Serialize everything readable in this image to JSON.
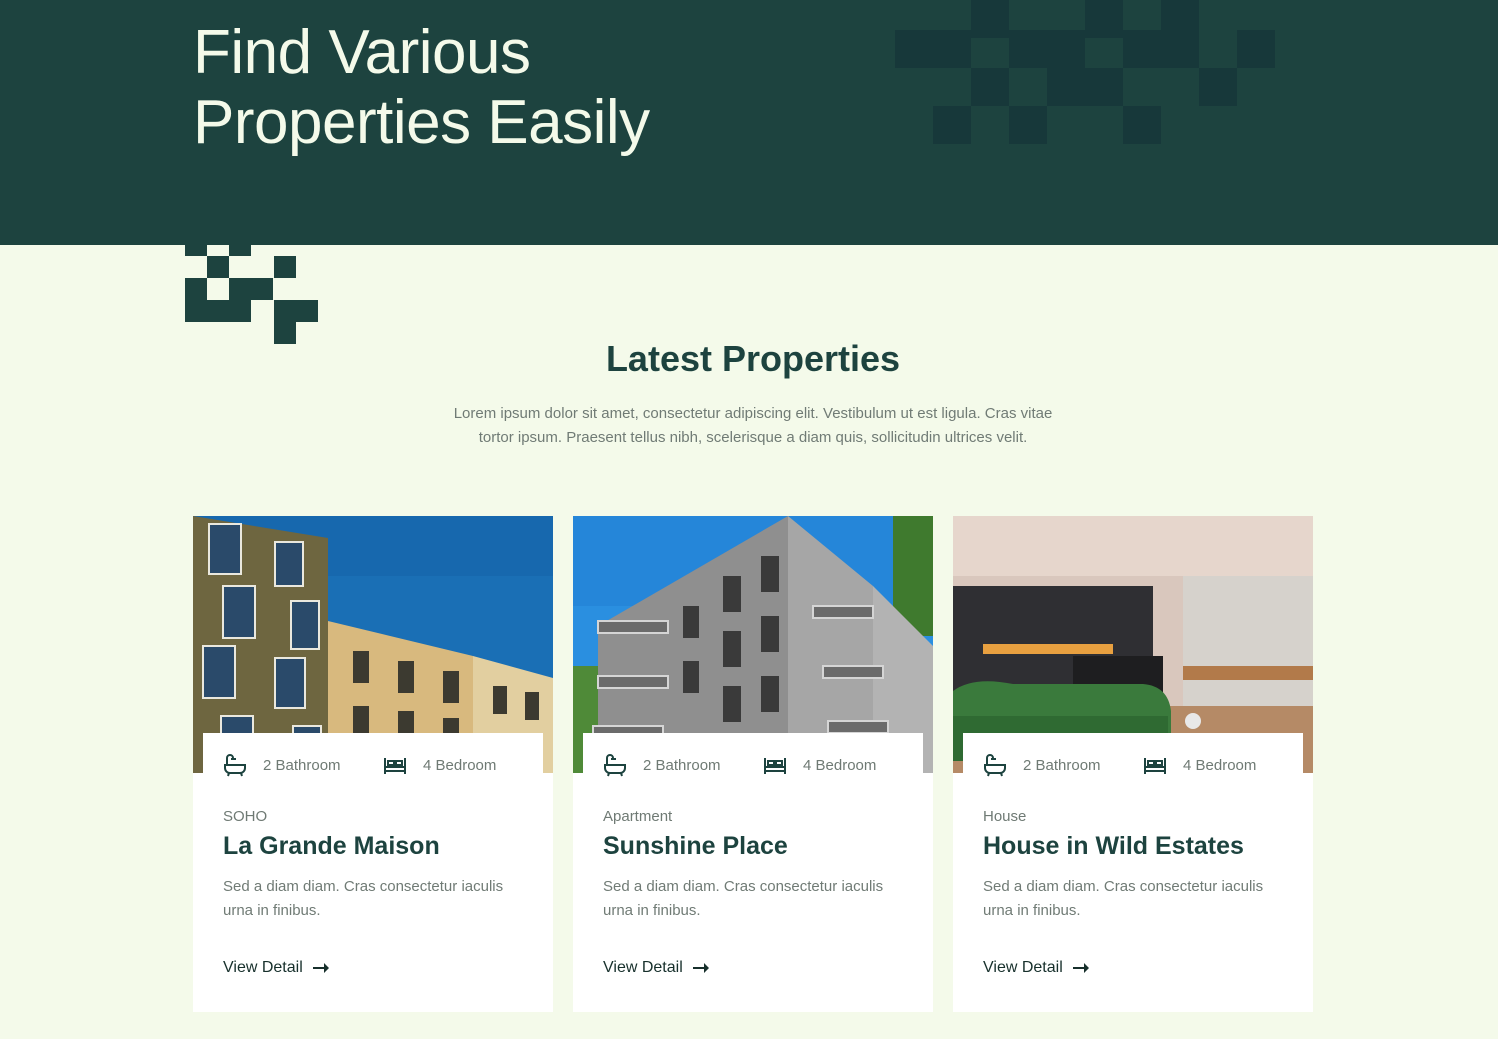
{
  "hero": {
    "title_line1": "Find Various",
    "title_line2": "Properties Easily"
  },
  "latest": {
    "title": "Latest Properties",
    "description": "Lorem ipsum dolor sit amet, consectetur adipiscing elit. Vestibulum ut est ligula. Cras vitae tortor ipsum. Praesent tellus nibh, scelerisque a diam quis, sollicitudin ultrices velit."
  },
  "properties": [
    {
      "bathrooms": "2 Bathroom",
      "bedrooms": "4 Bedroom",
      "category": "SOHO",
      "name": "La Grande Maison",
      "summary": "Sed a diam diam. Cras consectetur iaculis urna in finibus.",
      "cta": "View Detail"
    },
    {
      "bathrooms": "2 Bathroom",
      "bedrooms": "4 Bedroom",
      "category": "Apartment",
      "name": "Sunshine Place",
      "summary": "Sed a diam diam. Cras consectetur iaculis urna in finibus.",
      "cta": "View Detail"
    },
    {
      "bathrooms": "2 Bathroom",
      "bedrooms": "4 Bedroom",
      "category": "House",
      "name": "House in Wild Estates",
      "summary": "Sed a diam diam. Cras consectetur iaculis urna in finibus.",
      "cta": "View Detail"
    }
  ],
  "icons": {
    "bath": "bathtub-icon",
    "bed": "bed-icon",
    "arrow": "arrow-right-icon"
  },
  "colors": {
    "brand_dark": "#1d433f",
    "background": "#f4faea",
    "hero_text": "#f4faea",
    "muted_text": "#707b75"
  }
}
